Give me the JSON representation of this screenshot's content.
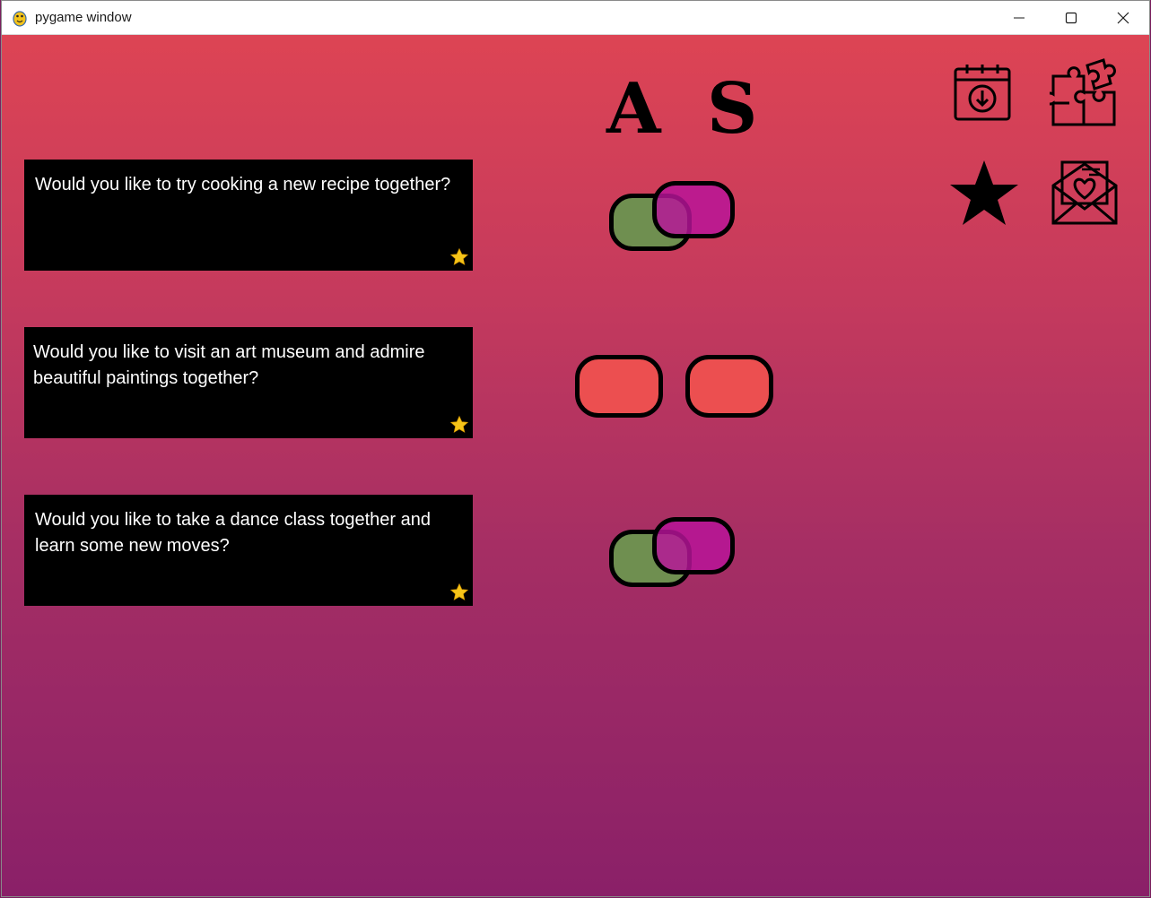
{
  "window": {
    "title": "pygame window",
    "controls": {
      "minimize": "minimize-icon",
      "maximize": "maximize-icon",
      "close": "close-icon"
    }
  },
  "header": {
    "letter_a": "A",
    "letter_s": "S"
  },
  "questions": [
    {
      "text": "Would you like to try cooking a new recipe together?",
      "starred": true,
      "toggle": "overlap"
    },
    {
      "text": "Would you like to visit an art museum and admire beautiful paintings together?",
      "starred": true,
      "toggle": "separate"
    },
    {
      "text": "Would you like to take a dance class together and learn some new moves?",
      "starred": true,
      "toggle": "overlap"
    }
  ],
  "icons": [
    "calendar-download-icon",
    "puzzle-icon",
    "star-icon",
    "love-letter-icon"
  ],
  "colors": {
    "gradient_top": "#dd4454",
    "gradient_bottom": "#8a2068",
    "card_bg": "#000000",
    "card_text": "#ffffff",
    "pill_green": "#6f8f50",
    "pill_magenta": "#b8139a",
    "pill_red": "#ec4f50",
    "star_gold": "#f5c419"
  }
}
